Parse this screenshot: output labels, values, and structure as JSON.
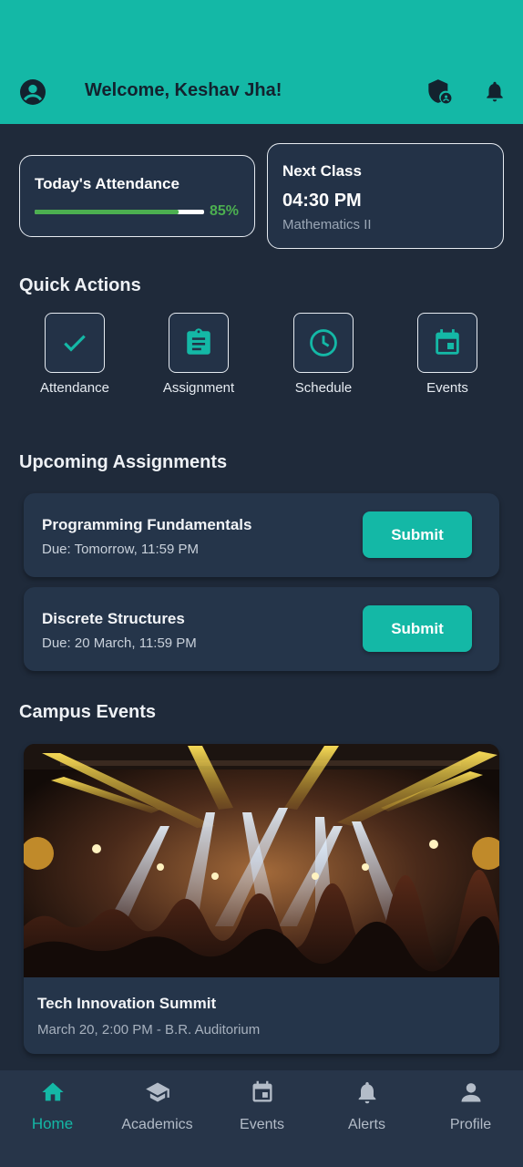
{
  "header": {
    "welcome": "Welcome, Keshav Jha!",
    "icons": [
      "account-circle-icon",
      "shield-account-icon",
      "bell-icon"
    ]
  },
  "attendance": {
    "title": "Today's Attendance",
    "percent_label": "85%",
    "percent": 0.85
  },
  "next_class": {
    "label": "Next Class",
    "time": "04:30 PM",
    "subject": "Mathematics II"
  },
  "quick_actions": {
    "title": "Quick Actions",
    "items": [
      {
        "label": "Attendance",
        "icon": "check-icon"
      },
      {
        "label": "Assignment",
        "icon": "clipboard-icon"
      },
      {
        "label": "Schedule",
        "icon": "clock-icon"
      },
      {
        "label": "Events",
        "icon": "calendar-icon"
      }
    ]
  },
  "assignments": {
    "title": "Upcoming Assignments",
    "items": [
      {
        "name": "Programming Fundamentals",
        "due": "Due: Tomorrow, 11:59 PM",
        "button": "Submit"
      },
      {
        "name": "Discrete Structures",
        "due": "Due: 20 March, 11:59 PM",
        "button": "Submit"
      }
    ]
  },
  "events": {
    "title": "Campus Events",
    "items": [
      {
        "title": "Tech Innovation Summit",
        "meta": "March 20, 2:00 PM - B.R. Auditorium"
      }
    ]
  },
  "nav": {
    "items": [
      {
        "label": "Home",
        "icon": "home-icon",
        "active": true
      },
      {
        "label": "Academics",
        "icon": "graduation-cap-icon",
        "active": false
      },
      {
        "label": "Events",
        "icon": "calendar-icon",
        "active": false
      },
      {
        "label": "Alerts",
        "icon": "bell-icon",
        "active": false
      },
      {
        "label": "Profile",
        "icon": "person-icon",
        "active": false
      }
    ]
  },
  "colors": {
    "accent": "#14b8a6",
    "background": "#1f2a3a",
    "card": "#233247",
    "progress": "#4caf50"
  }
}
